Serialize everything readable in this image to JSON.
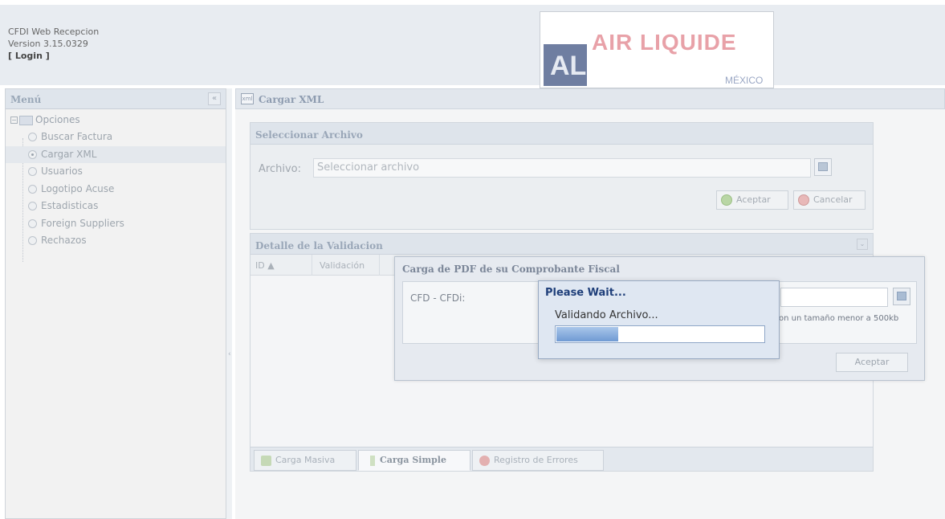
{
  "header": {
    "app_name": "CFDI Web Recepcion",
    "version": "Version 3.15.0329",
    "login": "[ Login ]",
    "logo": {
      "mark": "AL",
      "brand": "AIR LIQUIDE",
      "country": "MÉXICO"
    }
  },
  "sidebar": {
    "title": "Menú",
    "collapse_glyph": "«",
    "root_label": "Opciones",
    "items": [
      {
        "label": "Buscar Factura",
        "selected": false
      },
      {
        "label": "Cargar XML",
        "selected": true
      },
      {
        "label": "Usuarios",
        "selected": false
      },
      {
        "label": "Logotipo Acuse",
        "selected": false
      },
      {
        "label": "Estadisticas",
        "selected": false
      },
      {
        "label": "Foreign Suppliers",
        "selected": false
      },
      {
        "label": "Rechazos",
        "selected": false
      }
    ]
  },
  "main": {
    "title": "Cargar XML",
    "select_panel": {
      "title": "Seleccionar Archivo",
      "file_label": "Archivo:",
      "file_placeholder": "Seleccionar archivo",
      "accept_label": "Aceptar",
      "cancel_label": "Cancelar"
    },
    "detail_panel": {
      "title": "Detalle de la Validacion",
      "columns": [
        "ID ▲",
        "Validación"
      ],
      "tabs": [
        {
          "label": "Carga Masiva",
          "active": false
        },
        {
          "label": "Carga Simple",
          "active": true
        },
        {
          "label": "Registro de Errores",
          "active": false
        }
      ]
    }
  },
  "pdf_dialog": {
    "title": "Carga de PDF de su Comprobante Fiscal",
    "field_label": "CFD - CFDi:",
    "hint": "on un tamaño menor a 500kb",
    "accept_label": "Aceptar"
  },
  "wait_dialog": {
    "title": "Please Wait...",
    "message": "Validando Archivo...",
    "progress": 0.3
  },
  "colors": {
    "wait_title": "#1f3f7a",
    "progress_fill": "#6f9ad3",
    "logo_brand": "#e8a1a8"
  }
}
